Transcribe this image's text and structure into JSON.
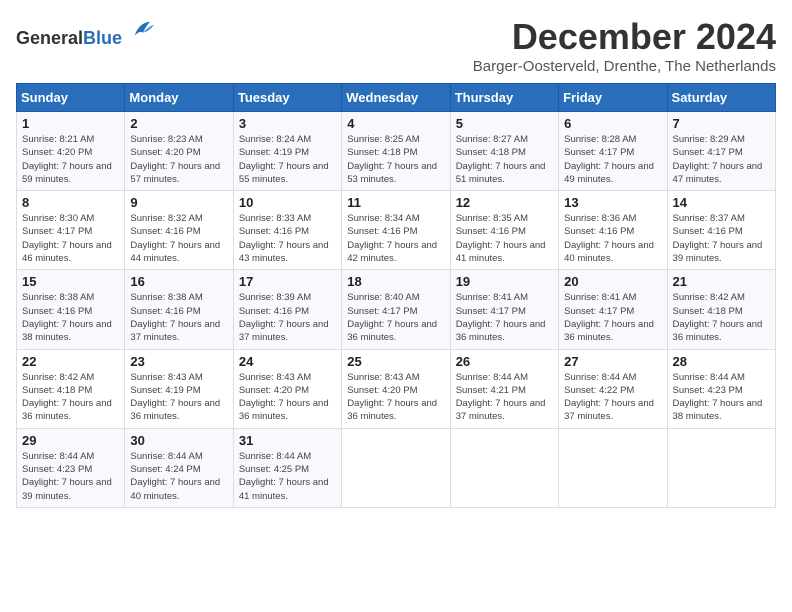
{
  "header": {
    "logo_general": "General",
    "logo_blue": "Blue",
    "month_title": "December 2024",
    "subtitle": "Barger-Oosterveld, Drenthe, The Netherlands"
  },
  "days_of_week": [
    "Sunday",
    "Monday",
    "Tuesday",
    "Wednesday",
    "Thursday",
    "Friday",
    "Saturday"
  ],
  "weeks": [
    [
      {
        "day": "1",
        "sunrise": "8:21 AM",
        "sunset": "4:20 PM",
        "daylight": "7 hours and 59 minutes."
      },
      {
        "day": "2",
        "sunrise": "8:23 AM",
        "sunset": "4:20 PM",
        "daylight": "7 hours and 57 minutes."
      },
      {
        "day": "3",
        "sunrise": "8:24 AM",
        "sunset": "4:19 PM",
        "daylight": "7 hours and 55 minutes."
      },
      {
        "day": "4",
        "sunrise": "8:25 AM",
        "sunset": "4:18 PM",
        "daylight": "7 hours and 53 minutes."
      },
      {
        "day": "5",
        "sunrise": "8:27 AM",
        "sunset": "4:18 PM",
        "daylight": "7 hours and 51 minutes."
      },
      {
        "day": "6",
        "sunrise": "8:28 AM",
        "sunset": "4:17 PM",
        "daylight": "7 hours and 49 minutes."
      },
      {
        "day": "7",
        "sunrise": "8:29 AM",
        "sunset": "4:17 PM",
        "daylight": "7 hours and 47 minutes."
      }
    ],
    [
      {
        "day": "8",
        "sunrise": "8:30 AM",
        "sunset": "4:17 PM",
        "daylight": "7 hours and 46 minutes."
      },
      {
        "day": "9",
        "sunrise": "8:32 AM",
        "sunset": "4:16 PM",
        "daylight": "7 hours and 44 minutes."
      },
      {
        "day": "10",
        "sunrise": "8:33 AM",
        "sunset": "4:16 PM",
        "daylight": "7 hours and 43 minutes."
      },
      {
        "day": "11",
        "sunrise": "8:34 AM",
        "sunset": "4:16 PM",
        "daylight": "7 hours and 42 minutes."
      },
      {
        "day": "12",
        "sunrise": "8:35 AM",
        "sunset": "4:16 PM",
        "daylight": "7 hours and 41 minutes."
      },
      {
        "day": "13",
        "sunrise": "8:36 AM",
        "sunset": "4:16 PM",
        "daylight": "7 hours and 40 minutes."
      },
      {
        "day": "14",
        "sunrise": "8:37 AM",
        "sunset": "4:16 PM",
        "daylight": "7 hours and 39 minutes."
      }
    ],
    [
      {
        "day": "15",
        "sunrise": "8:38 AM",
        "sunset": "4:16 PM",
        "daylight": "7 hours and 38 minutes."
      },
      {
        "day": "16",
        "sunrise": "8:38 AM",
        "sunset": "4:16 PM",
        "daylight": "7 hours and 37 minutes."
      },
      {
        "day": "17",
        "sunrise": "8:39 AM",
        "sunset": "4:16 PM",
        "daylight": "7 hours and 37 minutes."
      },
      {
        "day": "18",
        "sunrise": "8:40 AM",
        "sunset": "4:17 PM",
        "daylight": "7 hours and 36 minutes."
      },
      {
        "day": "19",
        "sunrise": "8:41 AM",
        "sunset": "4:17 PM",
        "daylight": "7 hours and 36 minutes."
      },
      {
        "day": "20",
        "sunrise": "8:41 AM",
        "sunset": "4:17 PM",
        "daylight": "7 hours and 36 minutes."
      },
      {
        "day": "21",
        "sunrise": "8:42 AM",
        "sunset": "4:18 PM",
        "daylight": "7 hours and 36 minutes."
      }
    ],
    [
      {
        "day": "22",
        "sunrise": "8:42 AM",
        "sunset": "4:18 PM",
        "daylight": "7 hours and 36 minutes."
      },
      {
        "day": "23",
        "sunrise": "8:43 AM",
        "sunset": "4:19 PM",
        "daylight": "7 hours and 36 minutes."
      },
      {
        "day": "24",
        "sunrise": "8:43 AM",
        "sunset": "4:20 PM",
        "daylight": "7 hours and 36 minutes."
      },
      {
        "day": "25",
        "sunrise": "8:43 AM",
        "sunset": "4:20 PM",
        "daylight": "7 hours and 36 minutes."
      },
      {
        "day": "26",
        "sunrise": "8:44 AM",
        "sunset": "4:21 PM",
        "daylight": "7 hours and 37 minutes."
      },
      {
        "day": "27",
        "sunrise": "8:44 AM",
        "sunset": "4:22 PM",
        "daylight": "7 hours and 37 minutes."
      },
      {
        "day": "28",
        "sunrise": "8:44 AM",
        "sunset": "4:23 PM",
        "daylight": "7 hours and 38 minutes."
      }
    ],
    [
      {
        "day": "29",
        "sunrise": "8:44 AM",
        "sunset": "4:23 PM",
        "daylight": "7 hours and 39 minutes."
      },
      {
        "day": "30",
        "sunrise": "8:44 AM",
        "sunset": "4:24 PM",
        "daylight": "7 hours and 40 minutes."
      },
      {
        "day": "31",
        "sunrise": "8:44 AM",
        "sunset": "4:25 PM",
        "daylight": "7 hours and 41 minutes."
      },
      null,
      null,
      null,
      null
    ]
  ]
}
